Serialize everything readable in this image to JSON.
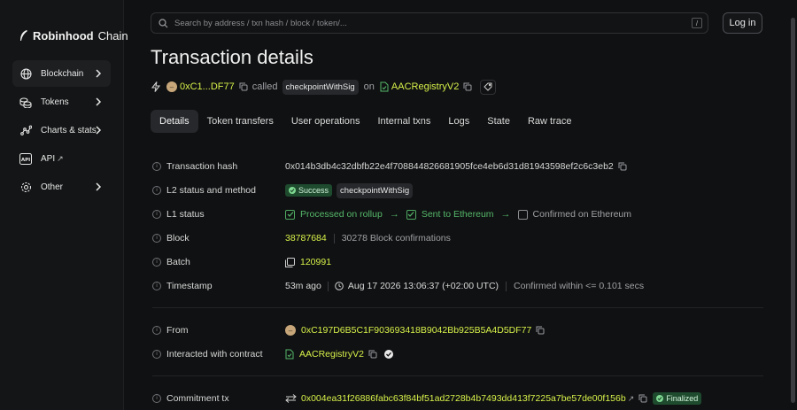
{
  "brand": {
    "name_bold": "Robinhood",
    "name_light": "Chain"
  },
  "sidebar": {
    "items": [
      {
        "label": "Blockchain",
        "icon": "globe-icon"
      },
      {
        "label": "Tokens",
        "icon": "coins-icon"
      },
      {
        "label": "Charts & stats",
        "icon": "chart-icon"
      },
      {
        "label": "API",
        "icon": "api-icon",
        "external": "↗"
      },
      {
        "label": "Other",
        "icon": "gear-icon"
      }
    ]
  },
  "header": {
    "search_placeholder": "Search by address / txn hash / block / token/...",
    "search_shortcut": "/",
    "login_label": "Log in"
  },
  "page": {
    "title": "Transaction details",
    "from_short": "0xC1...DF77",
    "called": "called",
    "method": "checkpointWithSig",
    "on": "on",
    "contract": "AACRegistryV2"
  },
  "tabs": [
    "Details",
    "Token transfers",
    "User operations",
    "Internal txns",
    "Logs",
    "State",
    "Raw trace"
  ],
  "details": {
    "tx_hash_label": "Transaction hash",
    "tx_hash": "0x014b3db4c32dbfb22e4f708844826681905fce4eb6d31d81943598ef2c6c3eb2",
    "l2_status_label": "L2 status and method",
    "l2_status": "Success",
    "l2_method": "checkpointWithSig",
    "l1_status_label": "L1 status",
    "l1_steps": [
      "Processed on rollup",
      "Sent to Ethereum",
      "Confirmed on Ethereum"
    ],
    "block_label": "Block",
    "block": "38787684",
    "block_confirmations": "30278 Block confirmations",
    "batch_label": "Batch",
    "batch": "120991",
    "timestamp_label": "Timestamp",
    "timestamp_ago": "53m ago",
    "timestamp_full": "Aug 17 2026 13:06:37 (+02:00 UTC)",
    "timestamp_confirmed": "Confirmed within <= 0.101 secs",
    "from_label": "From",
    "from_full": "0xC197D6B5C1F903693418B9042Bb925B5A4D5DF77",
    "interacted_label": "Interacted with contract",
    "interacted": "AACRegistryV2",
    "commitment_label": "Commitment tx",
    "commitment_tx": "0x004ea31f26886fabc63f84bf51ad2728b4b7493dd413f7225a7be57de00f156b",
    "commitment_status": "Finalized"
  },
  "colors": {
    "accent": "#d7f24a",
    "success": "#55b86a",
    "background": "#101112"
  }
}
